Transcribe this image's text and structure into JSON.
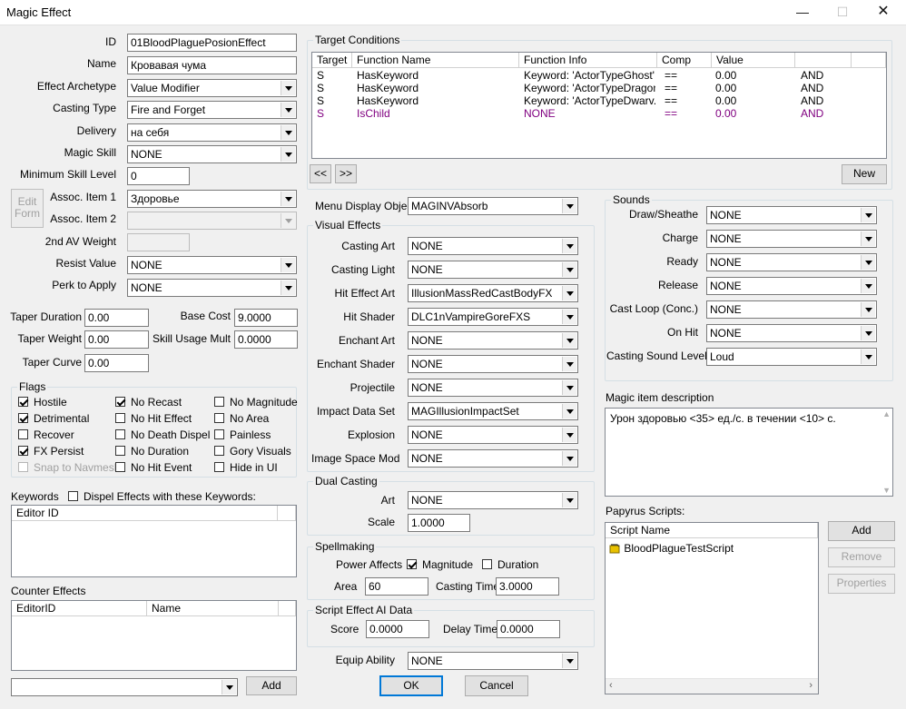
{
  "window": {
    "title": "Magic Effect",
    "minimize": "—",
    "maximize": "☐",
    "close": "✕"
  },
  "left": {
    "id_label": "ID",
    "id_value": "01BloodPlaguePosionEffect",
    "name_label": "Name",
    "name_value": "Кровавая чума",
    "archetype_label": "Effect Archetype",
    "archetype_value": "Value Modifier",
    "casting_type_label": "Casting Type",
    "casting_type_value": "Fire and Forget",
    "delivery_label": "Delivery",
    "delivery_value": "на себя",
    "magic_skill_label": "Magic Skill",
    "magic_skill_value": "NONE",
    "min_skill_label": "Minimum Skill Level",
    "min_skill_value": "0",
    "edit_form_label": "Edit Form",
    "assoc1_label": "Assoc. Item 1",
    "assoc1_value": "Здоровье",
    "assoc2_label": "Assoc. Item 2",
    "assoc2_value": "",
    "av2_label": "2nd AV Weight",
    "av2_value": "",
    "resist_label": "Resist Value",
    "resist_value": "NONE",
    "perk_label": "Perk to Apply",
    "perk_value": "NONE",
    "taper_duration_label": "Taper Duration",
    "taper_duration_value": "0.00",
    "taper_weight_label": "Taper Weight",
    "taper_weight_value": "0.00",
    "taper_curve_label": "Taper Curve",
    "taper_curve_value": "0.00",
    "base_cost_label": "Base Cost",
    "base_cost_value": "9.0000",
    "skill_mult_label": "Skill Usage Mult",
    "skill_mult_value": "0.0000"
  },
  "flags": {
    "label": "Flags",
    "items": [
      {
        "label": "Hostile",
        "checked": true
      },
      {
        "label": "Detrimental",
        "checked": true
      },
      {
        "label": "Recover",
        "checked": false
      },
      {
        "label": "FX Persist",
        "checked": true
      },
      {
        "label": "Snap to Navmesh",
        "checked": false
      },
      {
        "label": "No Recast",
        "checked": true
      },
      {
        "label": "No Hit Effect",
        "checked": false
      },
      {
        "label": "No Death Dispel",
        "checked": false
      },
      {
        "label": "No Duration",
        "checked": false
      },
      {
        "label": "No Hit Event",
        "checked": false
      },
      {
        "label": "No Magnitude",
        "checked": false
      },
      {
        "label": "No Area",
        "checked": false
      },
      {
        "label": "Painless",
        "checked": false
      },
      {
        "label": "Gory Visuals",
        "checked": false
      },
      {
        "label": "Hide in UI",
        "checked": false
      }
    ]
  },
  "keywords": {
    "label": "Keywords",
    "dispel_label": "Dispel Effects with these Keywords:",
    "column": "Editor ID"
  },
  "counter": {
    "label": "Counter Effects",
    "col1": "EditorID",
    "col2": "Name",
    "add_label": "Add",
    "combo_value": ""
  },
  "target": {
    "label": "Target Conditions",
    "columns": [
      "Target",
      "Function Name",
      "Function Info",
      "Comp",
      "Value",
      ""
    ],
    "rows": [
      {
        "target": "S",
        "func": "HasKeyword",
        "info": "Keyword: 'ActorTypeGhost'",
        "comp": "==",
        "value": "0.00",
        "op": "AND"
      },
      {
        "target": "S",
        "func": "HasKeyword",
        "info": "Keyword: 'ActorTypeDragon'",
        "comp": "==",
        "value": "0.00",
        "op": "AND"
      },
      {
        "target": "S",
        "func": "HasKeyword",
        "info": "Keyword: 'ActorTypeDwarv...",
        "comp": "==",
        "value": "0.00",
        "op": "AND"
      },
      {
        "target": "S",
        "func": "IsChild",
        "info": "NONE",
        "comp": "==",
        "value": "0.00",
        "op": "AND"
      }
    ],
    "prev_label": "<<",
    "next_label": ">>",
    "new_label": "New"
  },
  "menu_display": {
    "label": "Menu Display Object",
    "value": "MAGINVAbsorb"
  },
  "visual": {
    "label": "Visual Effects",
    "casting_art_label": "Casting Art",
    "casting_art": "NONE",
    "casting_light_label": "Casting Light",
    "casting_light": "NONE",
    "hit_art_label": "Hit Effect Art",
    "hit_art": "IllusionMassRedCastBodyFX",
    "hit_shader_label": "Hit Shader",
    "hit_shader": "DLC1nVampireGoreFXS",
    "enchant_art_label": "Enchant Art",
    "enchant_art": "NONE",
    "enchant_shader_label": "Enchant Shader",
    "enchant_shader": "NONE",
    "projectile_label": "Projectile",
    "projectile": "NONE",
    "impact_label": "Impact Data Set",
    "impact": "MAGIllusionImpactSet",
    "explosion_label": "Explosion",
    "explosion": "NONE",
    "ism_label": "Image Space Mod",
    "ism": "NONE"
  },
  "dual": {
    "label": "Dual Casting",
    "art_label": "Art",
    "art": "NONE",
    "scale_label": "Scale",
    "scale": "1.0000"
  },
  "spell": {
    "label": "Spellmaking",
    "power_label": "Power Affects",
    "magnitude_label": "Magnitude",
    "duration_label": "Duration",
    "area_label": "Area",
    "area": "60",
    "time_label": "Casting Time",
    "time": "3.0000"
  },
  "ai": {
    "label": "Script Effect AI Data",
    "score_label": "Score",
    "score": "0.0000",
    "delay_label": "Delay Time",
    "delay": "0.0000"
  },
  "equip": {
    "label": "Equip Ability",
    "value": "NONE"
  },
  "ok_label": "OK",
  "cancel_label": "Cancel",
  "sounds": {
    "label": "Sounds",
    "draw_label": "Draw/Sheathe",
    "draw": "NONE",
    "charge_label": "Charge",
    "charge": "NONE",
    "ready_label": "Ready",
    "ready": "NONE",
    "release_label": "Release",
    "release": "NONE",
    "loop_label": "Cast Loop (Conc.)",
    "loop": "NONE",
    "onhit_label": "On Hit",
    "onhit": "NONE",
    "level_label": "Casting Sound Level",
    "level": "Loud"
  },
  "description": {
    "label": "Magic item description",
    "text": "Урон здоровью <35> ед./с. в течении <10> с."
  },
  "papyrus": {
    "label": "Papyrus Scripts:",
    "column": "Script Name",
    "script": "BloodPlagueTestScript",
    "add_label": "Add",
    "remove_label": "Remove",
    "properties_label": "Properties"
  }
}
